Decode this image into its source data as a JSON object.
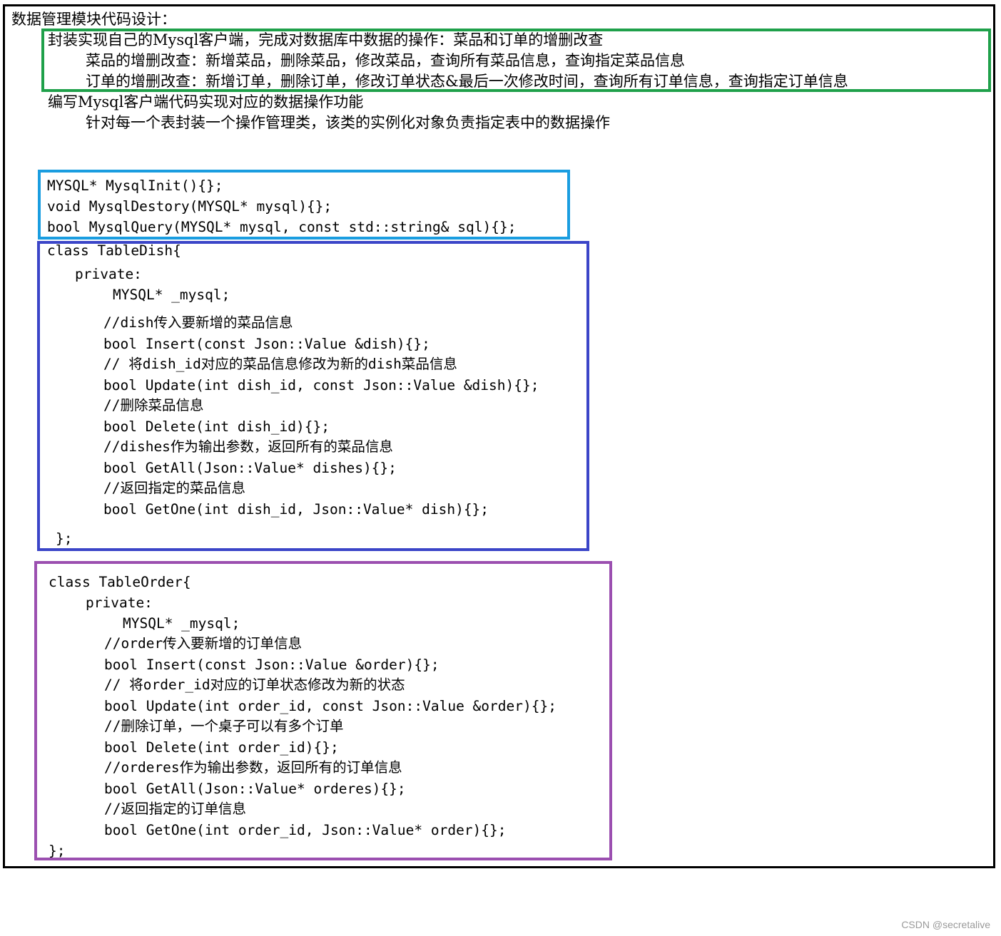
{
  "title": "数据管理模块代码设计：",
  "wrapper": {
    "heading": "封装实现自己的Mysql客户端，完成对数据库中数据的操作：菜品和订单的增删改查",
    "dish_ops": "菜品的增删改查：新增菜品，删除菜品，修改菜品，查询所有菜品信息，查询指定菜品信息",
    "order_ops": "订单的增删改查：新增订单，删除订单，修改订单状态&最后一次修改时间，查询所有订单信息，查询指定订单信息"
  },
  "client": {
    "heading": "编写Mysql客户端代码实现对应的数据操作功能",
    "note": "针对每一个表封装一个操作管理类，该类的实例化对象负责指定表中的数据操作"
  },
  "mysql_funcs": [
    "MYSQL* MysqlInit(){};",
    "void MysqlDestory(MYSQL* mysql){};",
    "bool MysqlQuery(MYSQL* mysql, const std::string& sql){};"
  ],
  "table_dish": {
    "open": "class TableDish{",
    "private": "private:",
    "member": "MYSQL* _mysql;",
    "body": [
      "//dish传入要新增的菜品信息",
      "bool Insert(const Json::Value &dish){};",
      "// 将dish_id对应的菜品信息修改为新的dish菜品信息",
      "bool Update(int dish_id, const Json::Value &dish){};",
      "//删除菜品信息",
      "bool Delete(int dish_id){};",
      "//dishes作为输出参数，返回所有的菜品信息",
      "bool GetAll(Json::Value* dishes){};",
      "//返回指定的菜品信息",
      "bool GetOne(int dish_id, Json::Value* dish){};"
    ],
    "close": "};"
  },
  "table_order": {
    "open": "class TableOrder{",
    "private": "private:",
    "member": "MYSQL* _mysql;",
    "body": [
      "//order传入要新增的订单信息",
      "bool Insert(const Json::Value &order){};",
      "// 将order_id对应的订单状态修改为新的状态",
      "bool Update(int order_id, const Json::Value &order){};",
      "//删除订单，一个桌子可以有多个订单",
      "bool Delete(int order_id){};",
      "//orderes作为输出参数，返回所有的订单信息",
      "bool GetAll(Json::Value* orderes){};",
      "//返回指定的订单信息",
      "bool GetOne(int order_id, Json::Value* order){};"
    ],
    "close": "};"
  },
  "watermark": "CSDN @secretalive",
  "colors": {
    "wrapper_box": "#1fa04a",
    "functions_box": "#1a9de0",
    "dish_box": "#3b45c8",
    "order_box": "#9b4fb0"
  }
}
